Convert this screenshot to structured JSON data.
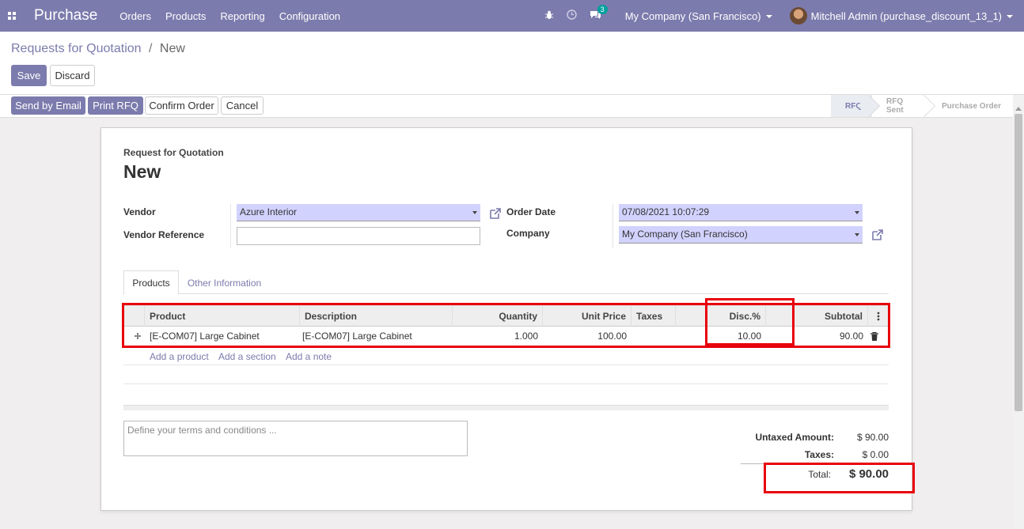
{
  "navbar": {
    "app_name": "Purchase",
    "menu": [
      "Orders",
      "Products",
      "Reporting",
      "Configuration"
    ],
    "chat_badge": "3",
    "company": "My Company (San Francisco)",
    "user": "Mitchell Admin (purchase_discount_13_1)",
    "color": "#7c7bad"
  },
  "breadcrumb": {
    "parent": "Requests for Quotation",
    "separator": "/",
    "current": "New"
  },
  "actions": {
    "save": "Save",
    "discard": "Discard"
  },
  "status_buttons": {
    "send_email": "Send by Email",
    "print_rfq": "Print RFQ",
    "confirm": "Confirm Order",
    "cancel": "Cancel"
  },
  "stages": [
    {
      "label": "RFQ",
      "active": true
    },
    {
      "label": "RFQ Sent",
      "active": false
    },
    {
      "label": "Purchase Order",
      "active": false
    }
  ],
  "form": {
    "doc_type": "Request for Quotation",
    "title": "New",
    "vendor_label": "Vendor",
    "vendor_value": "Azure Interior",
    "vendor_ref_label": "Vendor Reference",
    "vendor_ref_value": "",
    "order_date_label": "Order Date",
    "order_date_value": "07/08/2021 10:07:29",
    "company_label": "Company",
    "company_value": "My Company (San Francisco)"
  },
  "tabs": {
    "products": "Products",
    "other": "Other Information"
  },
  "table": {
    "headers": {
      "product": "Product",
      "description": "Description",
      "quantity": "Quantity",
      "unit_price": "Unit Price",
      "taxes": "Taxes",
      "disc": "Disc.%",
      "subtotal": "Subtotal"
    },
    "row": {
      "product": "[E-COM07] Large Cabinet",
      "description": "[E-COM07] Large Cabinet",
      "quantity": "1.000",
      "unit_price": "100.00",
      "taxes": "",
      "disc": "10.00",
      "subtotal": "90.00"
    },
    "add_product": "Add a product",
    "add_section": "Add a section",
    "add_note": "Add a note"
  },
  "terms_placeholder": "Define your terms and conditions ...",
  "totals": {
    "untaxed_label": "Untaxed Amount:",
    "untaxed_value": "$ 90.00",
    "taxes_label": "Taxes:",
    "taxes_value": "$ 0.00",
    "total_label": "Total:",
    "total_value": "$ 90.00"
  }
}
